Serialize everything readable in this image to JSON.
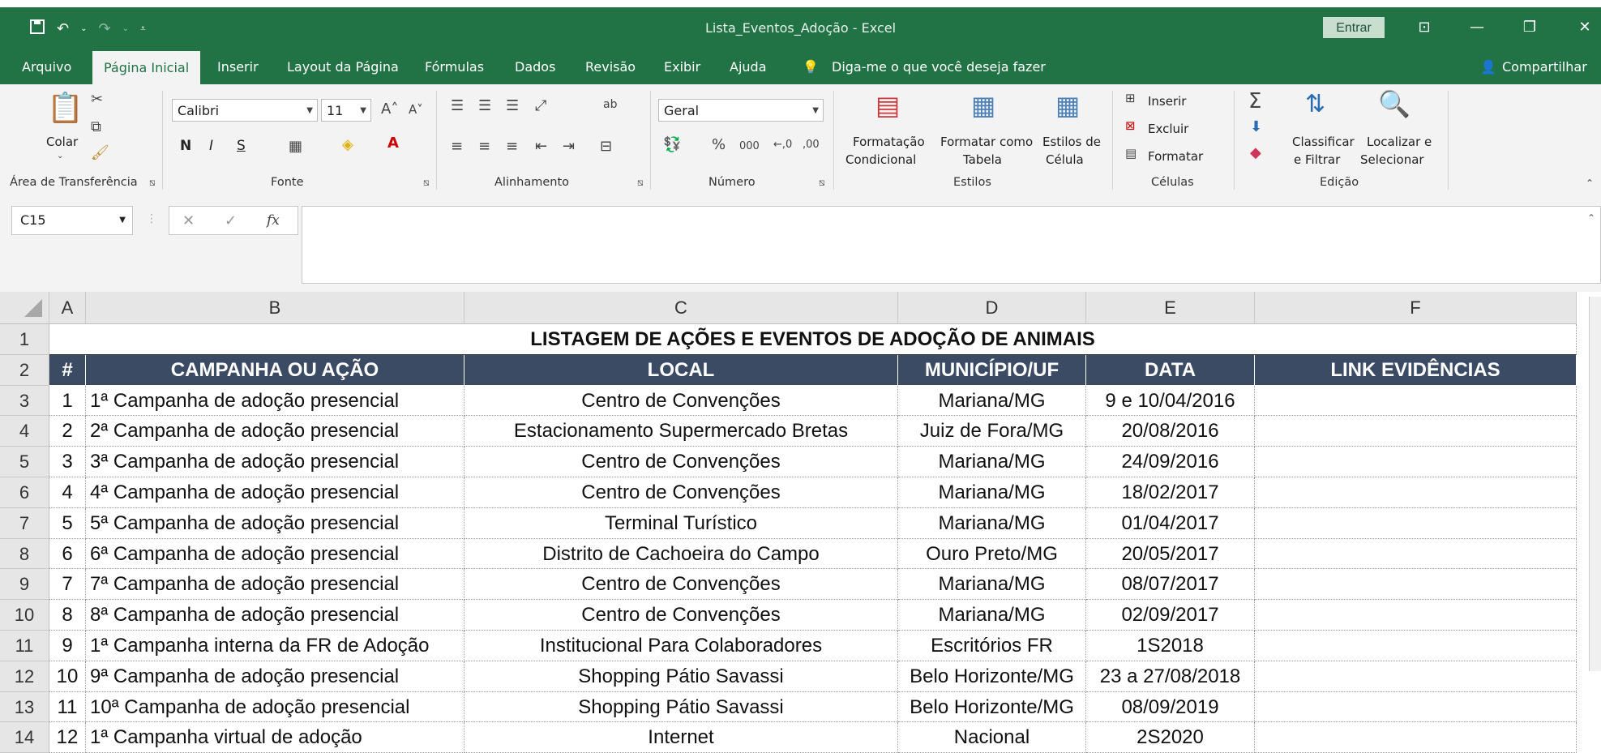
{
  "window": {
    "title": "Lista_Eventos_Adoção - Excel",
    "signin_label": "Entrar",
    "share_label": "Compartilhar"
  },
  "tabs": [
    {
      "label": "Arquivo"
    },
    {
      "label": "Página Inicial"
    },
    {
      "label": "Inserir"
    },
    {
      "label": "Layout da Página"
    },
    {
      "label": "Fórmulas"
    },
    {
      "label": "Dados"
    },
    {
      "label": "Revisão"
    },
    {
      "label": "Exibir"
    },
    {
      "label": "Ajuda"
    }
  ],
  "tell_me": "Diga-me o que você deseja fazer",
  "ribbon": {
    "clipboard": {
      "paste_label": "Colar",
      "group_label": "Área de Transferência"
    },
    "font": {
      "name": "Calibri",
      "size": "11",
      "bold": "N",
      "italic": "I",
      "underline": "S",
      "group_label": "Fonte"
    },
    "alignment": {
      "group_label": "Alinhamento"
    },
    "number": {
      "format": "Geral",
      "group_label": "Número"
    },
    "styles": {
      "conditional_label_1": "Formatação",
      "conditional_label_2": "Condicional",
      "table_label_1": "Formatar como",
      "table_label_2": "Tabela",
      "cell_styles_label_1": "Estilos de",
      "cell_styles_label_2": "Célula",
      "group_label": "Estilos"
    },
    "cells": {
      "insert_label": "Inserir",
      "delete_label": "Excluir",
      "format_label": "Formatar",
      "group_label": "Células"
    },
    "editing": {
      "sort_label_1": "Classificar",
      "sort_label_2": "e Filtrar",
      "find_label_1": "Localizar e",
      "find_label_2": "Selecionar",
      "group_label": "Edição"
    }
  },
  "formula_bar": {
    "name_box": "C15",
    "fx": "fx",
    "content": ""
  },
  "columns": [
    "A",
    "B",
    "C",
    "D",
    "E",
    "F"
  ],
  "sheet": {
    "title": "LISTAGEM DE AÇÕES E EVENTOS DE ADOÇÃO DE ANIMAIS",
    "headers": [
      "#",
      "CAMPANHA OU AÇÃO",
      "LOCAL",
      "MUNICÍPIO/UF",
      "DATA",
      "LINK EVIDÊNCIAS"
    ],
    "rows": [
      [
        "1",
        "1ª Campanha de adoção presencial",
        "Centro de Convenções",
        "Mariana/MG",
        "9 e 10/04/2016",
        ""
      ],
      [
        "2",
        "2ª Campanha de adoção presencial",
        "Estacionamento Supermercado Bretas",
        "Juiz de Fora/MG",
        "20/08/2016",
        ""
      ],
      [
        "3",
        "3ª Campanha de adoção presencial",
        "Centro de Convenções",
        "Mariana/MG",
        "24/09/2016",
        ""
      ],
      [
        "4",
        "4ª Campanha de adoção presencial",
        "Centro de Convenções",
        "Mariana/MG",
        "18/02/2017",
        ""
      ],
      [
        "5",
        "5ª Campanha de adoção presencial",
        "Terminal Turístico",
        "Mariana/MG",
        "01/04/2017",
        ""
      ],
      [
        "6",
        "6ª Campanha de adoção presencial",
        "Distrito de Cachoeira do Campo",
        "Ouro Preto/MG",
        "20/05/2017",
        ""
      ],
      [
        "7",
        "7ª Campanha de adoção presencial",
        "Centro de Convenções",
        "Mariana/MG",
        "08/07/2017",
        ""
      ],
      [
        "8",
        "8ª Campanha de adoção presencial",
        "Centro de Convenções",
        "Mariana/MG",
        "02/09/2017",
        ""
      ],
      [
        "9",
        "1ª Campanha interna da FR de Adoção",
        "Institucional Para Colaboradores",
        "Escritórios FR",
        "1S2018",
        ""
      ],
      [
        "10",
        "9ª Campanha de adoção presencial",
        "Shopping Pátio Savassi",
        "Belo Horizonte/MG",
        "23 a 27/08/2018",
        ""
      ],
      [
        "11",
        "10ª Campanha de adoção presencial",
        "Shopping Pátio Savassi",
        "Belo Horizonte/MG",
        "08/09/2019",
        ""
      ],
      [
        "12",
        "1ª Campanha virtual de adoção",
        "Internet",
        "Nacional",
        "2S2020",
        ""
      ]
    ]
  },
  "row_numbers": [
    "1",
    "2",
    "3",
    "4",
    "5",
    "6",
    "7",
    "8",
    "9",
    "10",
    "11",
    "12",
    "13",
    "14"
  ],
  "colors": {
    "excel_green": "#217346",
    "header_fill": "#3c4b64"
  }
}
